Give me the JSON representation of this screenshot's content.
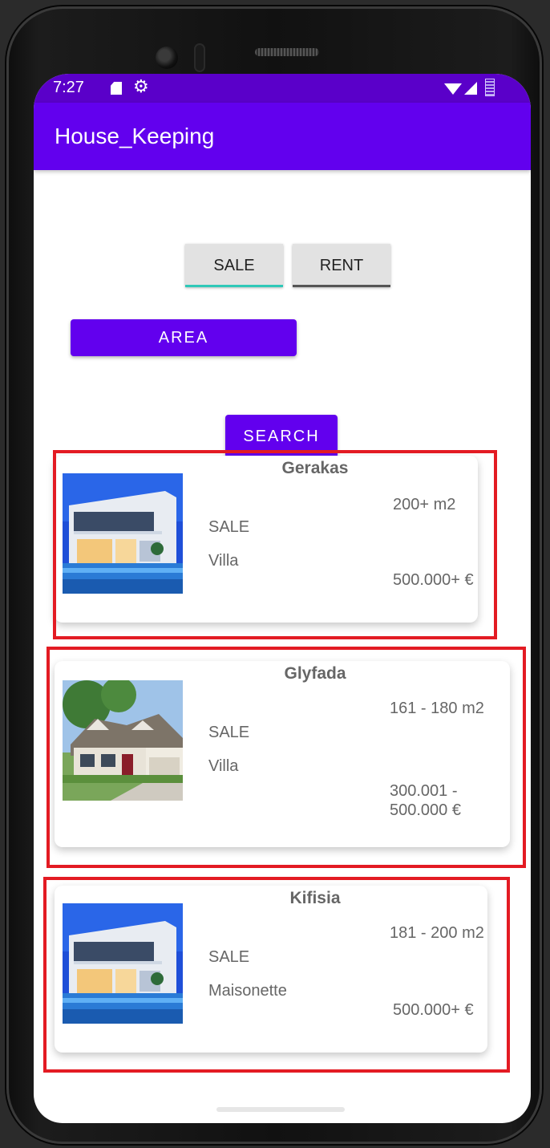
{
  "status_bar": {
    "time": "7:27"
  },
  "app_bar": {
    "title": "House_Keeping"
  },
  "filters": {
    "sale_label": "SALE",
    "rent_label": "RENT",
    "area_label": "AREA",
    "search_label": "SEARCH"
  },
  "listings": [
    {
      "area": "Gerakas",
      "size": "200+ m2",
      "type": "SALE",
      "category": "Villa",
      "price": "500.000+ €",
      "image": "modern-villa"
    },
    {
      "area": "Glyfada",
      "size": "161 - 180 m2",
      "type": "SALE",
      "category": "Villa",
      "price": "300.001 - 500.000 €",
      "image": "suburban-house"
    },
    {
      "area": "Kifisia",
      "size": "181 - 200 m2",
      "type": "SALE",
      "category": "Maisonette",
      "price": "500.000+ €",
      "image": "modern-villa"
    }
  ],
  "colors": {
    "primary": "#6200ee",
    "status_bar": "#5a00c9",
    "sale_indicator": "#2fc8b8",
    "highlight_box": "#e31b23"
  }
}
